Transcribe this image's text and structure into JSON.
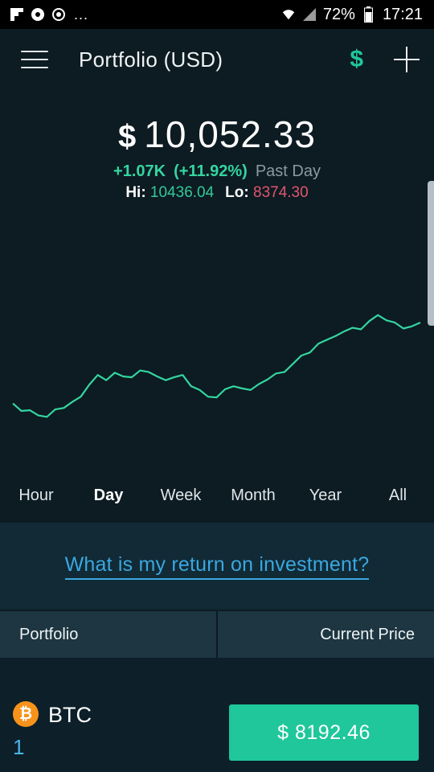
{
  "status_bar": {
    "battery": "72%",
    "time": "17:21",
    "ellipsis": "...",
    "icons": [
      "flipboard-icon",
      "messenger-icon",
      "sync-icon",
      "wifi-icon",
      "signal-icon",
      "battery-icon"
    ]
  },
  "header": {
    "title": "Portfolio (USD)",
    "currency_symbol": "$",
    "icons": [
      "menu-icon",
      "dollar-icon",
      "plus-icon"
    ]
  },
  "summary": {
    "currency": "$",
    "amount": "10,052.33",
    "change_abs": "+1.07K",
    "change_pct": "(+11.92%)",
    "change_label": "Past Day",
    "hi_label": "Hi:",
    "hi_value": "10436.04",
    "lo_label": "Lo:",
    "lo_value": "8374.30"
  },
  "ranges": [
    "Hour",
    "Day",
    "Week",
    "Month",
    "Year",
    "All"
  ],
  "active_range": "Day",
  "roi_link": "What is my return on investment?",
  "table": {
    "col_left": "Portfolio",
    "col_right": "Current Price"
  },
  "holdings": [
    {
      "symbol": "BTC",
      "quantity": "1",
      "price": "$ 8192.46",
      "icon": "bitcoin-icon",
      "icon_color": "#f7931a"
    }
  ],
  "colors": {
    "background": "#0d1b22",
    "accent_green": "#1fc79b",
    "positive": "#33d6a0",
    "negative": "#e0566f",
    "link": "#3ba7e0"
  },
  "chart_data": {
    "type": "line",
    "series": [
      {
        "values": [
          8700,
          8600,
          8610,
          8540,
          8520,
          8620,
          8640,
          8720,
          8790,
          8950,
          9080,
          9010,
          9110,
          9060,
          9050,
          9140,
          9120,
          9060,
          9010,
          9050,
          9080,
          8930,
          8880,
          8790,
          8780,
          8890,
          8930,
          8900,
          8880,
          8960,
          9020,
          9100,
          9120,
          9230,
          9340,
          9380,
          9500,
          9550,
          9600,
          9660,
          9710,
          9690,
          9800,
          9880,
          9810,
          9780,
          9700,
          9730,
          9780
        ]
      }
    ],
    "ylim": [
      8374.3,
      10436.04
    ],
    "grid": false
  }
}
